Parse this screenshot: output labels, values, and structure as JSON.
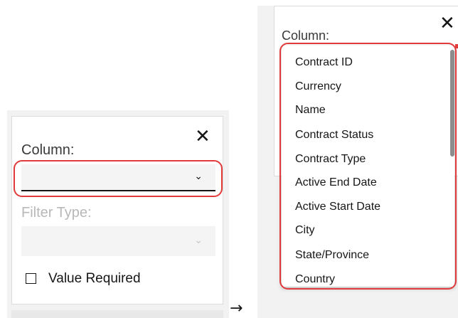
{
  "before": {
    "close_icon": "✕",
    "column_label": "Column:",
    "column_select_value": "",
    "chevron": "⌄",
    "filter_type_label": "Filter Type:",
    "filter_type_value": "",
    "value_required_label": "Value Required",
    "value_required_checked": false
  },
  "transition_arrow": "→",
  "after": {
    "close_icon": "✕",
    "column_label": "Column:",
    "dropdown_options": [
      "Contract ID",
      "Currency",
      "Name",
      "Contract Status",
      "Contract Type",
      "Active End Date",
      "Active Start Date",
      "City",
      "State/Province",
      "Country"
    ]
  },
  "colors": {
    "highlight": "#e03a3a",
    "field_background": "#f4f4f4",
    "panel_background": "#f2f2f2",
    "disabled_text": "#b8b8b8"
  }
}
